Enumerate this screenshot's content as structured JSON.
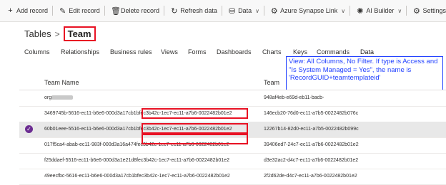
{
  "toolbar": {
    "add_record": "Add record",
    "edit_record": "Edit record",
    "delete_record": "Delete record",
    "refresh_data": "Refresh data",
    "data": "Data",
    "azure_synapse_link": "Azure Synapse Link",
    "ai_builder": "AI Builder",
    "settings": "Settings"
  },
  "breadcrumb": {
    "root": "Tables",
    "current": "Team"
  },
  "tabs": [
    "Columns",
    "Relationships",
    "Business rules",
    "Views",
    "Forms",
    "Dashboards",
    "Charts",
    "Keys",
    "Commands",
    "Data"
  ],
  "active_tab": "Data",
  "annotation": "View: All Columns, No Filter.  If type is Access and \"Is System Managed = Yes\", the name is 'RecordGUID+teamtemplateid'",
  "table": {
    "headers": {
      "name": "Team Name",
      "team": "Team"
    },
    "rows": [
      {
        "name": "org",
        "team": "948af4eb-e69d-eb11-bacb-"
      },
      {
        "name_prefix": "3469745b-5616-ec11-b6e6-000d3a17cb1b",
        "name_suffix": "fec3b42c-1ec7-ec11-a7b6-0022482b01e2",
        "team": "146ecb20-76d0-ec11-a7b5-0022482b076c"
      },
      {
        "name_prefix": "60b01eee-5516-ec11-b6e6-000d3a17cb1b",
        "name_suffix": "fec3b42c-1ec7-ec11-a7b6-0022482b01e2",
        "team": "12267b14-82d0-ec11-a7b5-0022482b099c"
      },
      {
        "name_prefix": "017f5ca4-abab-ec11-983f-000d3a16a474",
        "name_suffix": "fec3b42c-1ec7-ec11-a7b6-0022482b01e2",
        "team": "39406ed7-24c7-ec11-a7b6-0022482b01e2"
      },
      {
        "name": "f25ddaef-5516-ec11-b6e6-000d3a1e21d8fec3b42c-1ec7-ec11-a7b6-0022482b01e2",
        "team": "d3e32ac2-d4c7-ec11-a7b6-0022482b01e2"
      },
      {
        "name": "49eecfbc-5616-ec11-b6e6-000d3a17cb1bfec3b42c-1ec7-ec11-a7b6-0022482b01e2",
        "team": "2f2d62de-d4c7-ec11-a7b6-0022482b01e2"
      }
    ]
  }
}
